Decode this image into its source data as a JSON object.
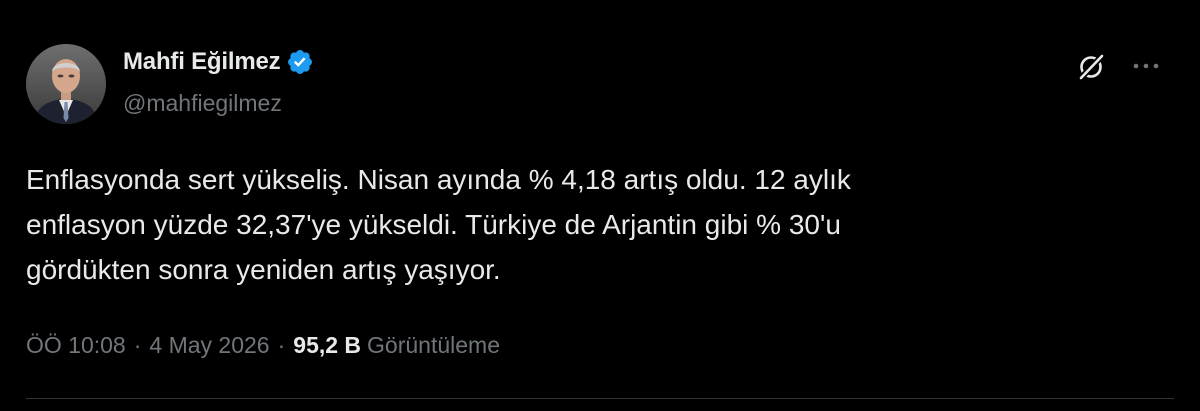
{
  "author": {
    "display_name": "Mahfi Eğilmez",
    "handle": "@mahfiegilmez",
    "verified": true
  },
  "tweet": {
    "text": "Enflasyonda sert yükseliş. Nisan ayında % 4,18 artış oldu. 12 aylık\nenflasyon yüzde 32,37'ye yükseldi. Türkiye de Arjantin gibi % 30'u\ngördükten sonra yeniden artış yaşıyor."
  },
  "meta": {
    "time": "ÖÖ 10:08",
    "separator": "·",
    "date": "4 May 2026",
    "views_count": "95,2 B",
    "views_label": "Görüntüleme"
  },
  "icons": {
    "verified": "verified-badge-icon",
    "grok": "grok-icon",
    "more": "more-icon"
  },
  "colors": {
    "background": "#000000",
    "primary_text": "#e7e9ea",
    "secondary_text": "#71767b",
    "verified_blue": "#1d9bf0",
    "divider": "#2f3336"
  }
}
